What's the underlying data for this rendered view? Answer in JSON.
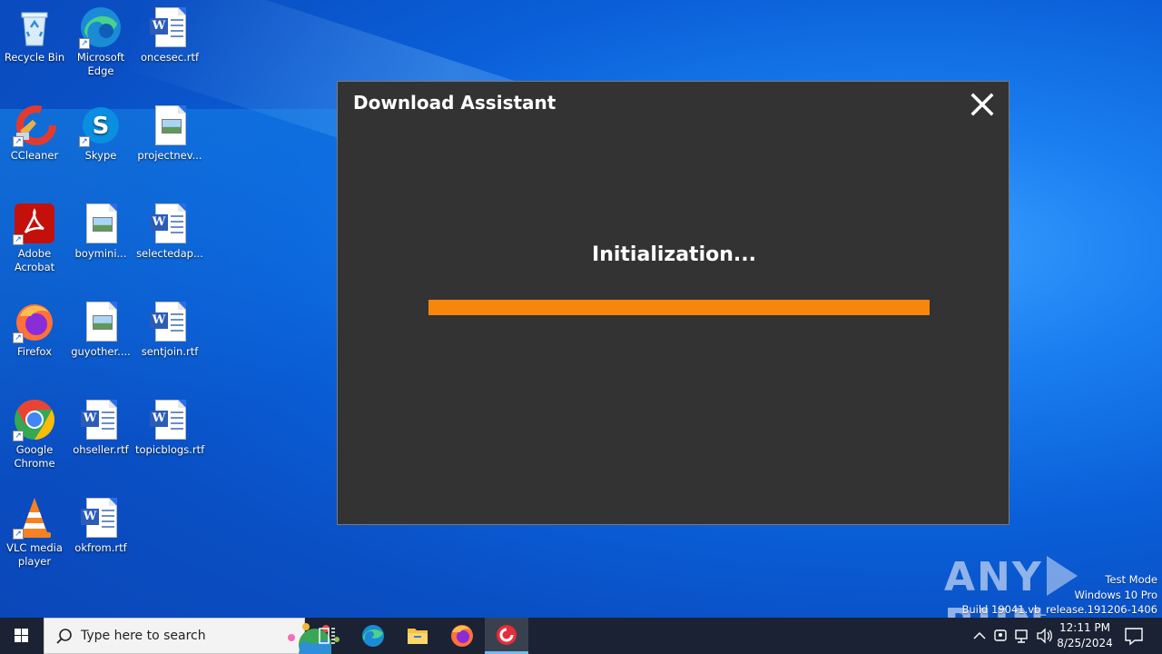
{
  "desktop": {
    "icons": [
      {
        "id": "recycle-bin",
        "label": "Recycle Bin"
      },
      {
        "id": "edge",
        "label": "Microsoft Edge"
      },
      {
        "id": "oncesec",
        "label": "oncesec.rtf"
      },
      {
        "id": "ccleaner",
        "label": "CCleaner"
      },
      {
        "id": "skype",
        "label": "Skype"
      },
      {
        "id": "projectnev",
        "label": "projectnev..."
      },
      {
        "id": "acrobat",
        "label": "Adobe Acrobat"
      },
      {
        "id": "boymini",
        "label": "boymini..."
      },
      {
        "id": "selectedap",
        "label": "selectedap..."
      },
      {
        "id": "firefox",
        "label": "Firefox"
      },
      {
        "id": "guyother",
        "label": "guyother...."
      },
      {
        "id": "sentjoin",
        "label": "sentjoin.rtf"
      },
      {
        "id": "chrome",
        "label": "Google Chrome"
      },
      {
        "id": "ohseller",
        "label": "ohseller.rtf"
      },
      {
        "id": "topicblogs",
        "label": "topicblogs.rtf"
      },
      {
        "id": "vlc",
        "label": "VLC media player"
      },
      {
        "id": "okfrom",
        "label": "okfrom.rtf"
      }
    ]
  },
  "dialog": {
    "title": "Download Assistant",
    "status": "Initialization...",
    "progress": 1.0,
    "progress_color": "#f7860d"
  },
  "watermark": {
    "text_left": "ANY",
    "text_right": "RUN"
  },
  "sysinfo": {
    "line1": "Test Mode",
    "line2": "Windows 10 Pro",
    "line3": "Build 19041.vb_release.191206-1406"
  },
  "taskbar": {
    "search_placeholder": "Type here to search",
    "time": "12:11 PM",
    "date": "8/25/2024"
  }
}
